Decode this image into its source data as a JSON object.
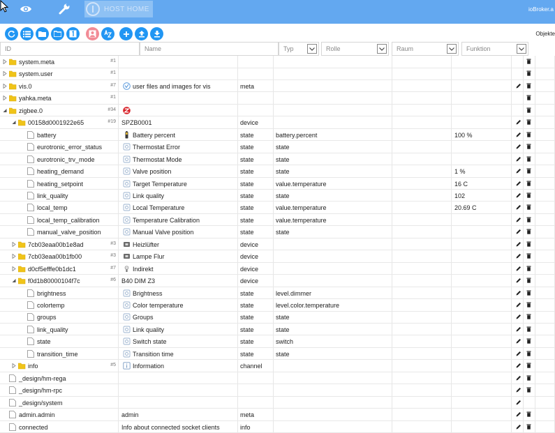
{
  "header": {
    "host_label": "HOST HOME",
    "brand": "ioBroker.a",
    "objekte": "Objekte"
  },
  "columns": {
    "id": "ID",
    "name": "Name",
    "typ": "Typ",
    "rolle": "Rolle",
    "raum": "Raum",
    "funktion": "Funktion"
  },
  "rows": [
    {
      "id": "system.meta",
      "count": "#1",
      "name": "",
      "type": "",
      "role": "",
      "value": "",
      "level": 0,
      "icon": "folder",
      "expand": "closed",
      "nicon": "",
      "actions": "del"
    },
    {
      "id": "system.user",
      "count": "#1",
      "name": "",
      "type": "",
      "role": "",
      "value": "",
      "level": 0,
      "icon": "folder",
      "expand": "closed",
      "nicon": "",
      "actions": "del"
    },
    {
      "id": "vis.0",
      "count": "#7",
      "name": "user files and images for vis",
      "type": "meta",
      "role": "",
      "value": "",
      "level": 0,
      "icon": "folder",
      "expand": "closed",
      "nicon": "vis",
      "actions": "both"
    },
    {
      "id": "yahka.meta",
      "count": "#1",
      "name": "",
      "type": "",
      "role": "",
      "value": "",
      "level": 0,
      "icon": "folder",
      "expand": "closed",
      "nicon": "",
      "actions": "del"
    },
    {
      "id": "zigbee.0",
      "count": "#34",
      "name": "",
      "type": "",
      "role": "",
      "value": "",
      "level": 0,
      "icon": "folder",
      "expand": "open",
      "nicon": "zigbee",
      "actions": "del"
    },
    {
      "id": "00158d0001922e65",
      "count": "#19",
      "name": "SPZB0001",
      "type": "device",
      "role": "",
      "value": "",
      "level": 1,
      "icon": "folder",
      "expand": "open",
      "nicon": "",
      "actions": "both"
    },
    {
      "id": "battery",
      "count": "",
      "name": "Battery percent",
      "type": "state",
      "role": "battery.percent",
      "value": "100 %",
      "level": 2,
      "icon": "file",
      "expand": "",
      "nicon": "battery",
      "actions": "both"
    },
    {
      "id": "eurotronic_error_status",
      "count": "",
      "name": "Thermostat Error",
      "type": "state",
      "role": "state",
      "value": "",
      "level": 2,
      "icon": "file",
      "expand": "",
      "nicon": "state",
      "actions": "both"
    },
    {
      "id": "eurotronic_trv_mode",
      "count": "",
      "name": "Thermostat Mode",
      "type": "state",
      "role": "state",
      "value": "",
      "level": 2,
      "icon": "file",
      "expand": "",
      "nicon": "state",
      "actions": "both"
    },
    {
      "id": "heating_demand",
      "count": "",
      "name": "Valve position",
      "type": "state",
      "role": "state",
      "value": "1 %",
      "level": 2,
      "icon": "file",
      "expand": "",
      "nicon": "state",
      "actions": "both"
    },
    {
      "id": "heating_setpoint",
      "count": "",
      "name": "Target Temperature",
      "type": "state",
      "role": "value.temperature",
      "value": "16 C",
      "level": 2,
      "icon": "file",
      "expand": "",
      "nicon": "state",
      "actions": "both"
    },
    {
      "id": "link_quality",
      "count": "",
      "name": "Link quality",
      "type": "state",
      "role": "state",
      "value": "102",
      "level": 2,
      "icon": "file",
      "expand": "",
      "nicon": "state",
      "actions": "both"
    },
    {
      "id": "local_temp",
      "count": "",
      "name": "Local Temperature",
      "type": "state",
      "role": "value.temperature",
      "value": "20.69 C",
      "level": 2,
      "icon": "file",
      "expand": "",
      "nicon": "state",
      "actions": "both"
    },
    {
      "id": "local_temp_calibration",
      "count": "",
      "name": "Temperature Calibration",
      "type": "state",
      "role": "value.temperature",
      "value": "",
      "level": 2,
      "icon": "file",
      "expand": "",
      "nicon": "state",
      "actions": "both"
    },
    {
      "id": "manual_valve_position",
      "count": "",
      "name": "Manual Valve position",
      "type": "state",
      "role": "state",
      "value": "",
      "level": 2,
      "icon": "file",
      "expand": "",
      "nicon": "state",
      "actions": "both"
    },
    {
      "id": "7cb03eaa00b1e8ad",
      "count": "#3",
      "name": "Heizlüfter",
      "type": "device",
      "role": "",
      "value": "",
      "level": 1,
      "icon": "folder",
      "expand": "closed",
      "nicon": "plug",
      "actions": "both"
    },
    {
      "id": "7cb03eaa00b1fb00",
      "count": "#3",
      "name": "Lampe Flur",
      "type": "device",
      "role": "",
      "value": "",
      "level": 1,
      "icon": "folder",
      "expand": "closed",
      "nicon": "plug",
      "actions": "both"
    },
    {
      "id": "d0cf5efffe0b1dc1",
      "count": "#7",
      "name": "Indirekt",
      "type": "device",
      "role": "",
      "value": "",
      "level": 1,
      "icon": "folder",
      "expand": "closed",
      "nicon": "bulb",
      "actions": "both"
    },
    {
      "id": "f0d1b80000104f7c",
      "count": "#6",
      "name": "B40 DIM Z3",
      "type": "device",
      "role": "",
      "value": "",
      "level": 1,
      "icon": "folder",
      "expand": "open",
      "nicon": "",
      "actions": "both"
    },
    {
      "id": "brightness",
      "count": "",
      "name": "Brightness",
      "type": "state",
      "role": "level.dimmer",
      "value": "",
      "level": 2,
      "icon": "file",
      "expand": "",
      "nicon": "state",
      "actions": "both"
    },
    {
      "id": "colortemp",
      "count": "",
      "name": "Color temperature",
      "type": "state",
      "role": "level.color.temperature",
      "value": "",
      "level": 2,
      "icon": "file",
      "expand": "",
      "nicon": "state",
      "actions": "both"
    },
    {
      "id": "groups",
      "count": "",
      "name": "Groups",
      "type": "state",
      "role": "state",
      "value": "",
      "level": 2,
      "icon": "file",
      "expand": "",
      "nicon": "state",
      "actions": "both"
    },
    {
      "id": "link_quality",
      "count": "",
      "name": "Link quality",
      "type": "state",
      "role": "state",
      "value": "",
      "level": 2,
      "icon": "file",
      "expand": "",
      "nicon": "state",
      "actions": "both"
    },
    {
      "id": "state",
      "count": "",
      "name": "Switch state",
      "type": "state",
      "role": "switch",
      "value": "",
      "level": 2,
      "icon": "file",
      "expand": "",
      "nicon": "state",
      "actions": "both"
    },
    {
      "id": "transition_time",
      "count": "",
      "name": "Transition time",
      "type": "state",
      "role": "state",
      "value": "",
      "level": 2,
      "icon": "file",
      "expand": "",
      "nicon": "state",
      "actions": "both"
    },
    {
      "id": "info",
      "count": "#5",
      "name": "Information",
      "type": "channel",
      "role": "",
      "value": "",
      "level": 1,
      "icon": "folder",
      "expand": "closed",
      "nicon": "info",
      "actions": "both"
    },
    {
      "id": "_design/hm-rega",
      "count": "",
      "name": "",
      "type": "",
      "role": "",
      "value": "",
      "level": 0,
      "icon": "file",
      "expand": "",
      "nicon": "",
      "actions": "both"
    },
    {
      "id": "_design/hm-rpc",
      "count": "",
      "name": "",
      "type": "",
      "role": "",
      "value": "",
      "level": 0,
      "icon": "file",
      "expand": "",
      "nicon": "",
      "actions": "both"
    },
    {
      "id": "_design/system",
      "count": "",
      "name": "",
      "type": "",
      "role": "",
      "value": "",
      "level": 0,
      "icon": "file",
      "expand": "",
      "nicon": "",
      "actions": "edit"
    },
    {
      "id": "admin.admin",
      "count": "",
      "name": "admin",
      "type": "meta",
      "role": "",
      "value": "",
      "level": 0,
      "icon": "file",
      "expand": "",
      "nicon": "",
      "actions": "both"
    },
    {
      "id": "connected",
      "count": "",
      "name": "Info about connected socket clients",
      "type": "info",
      "role": "",
      "value": "",
      "level": 0,
      "icon": "file",
      "expand": "",
      "nicon": "",
      "actions": "both"
    }
  ]
}
